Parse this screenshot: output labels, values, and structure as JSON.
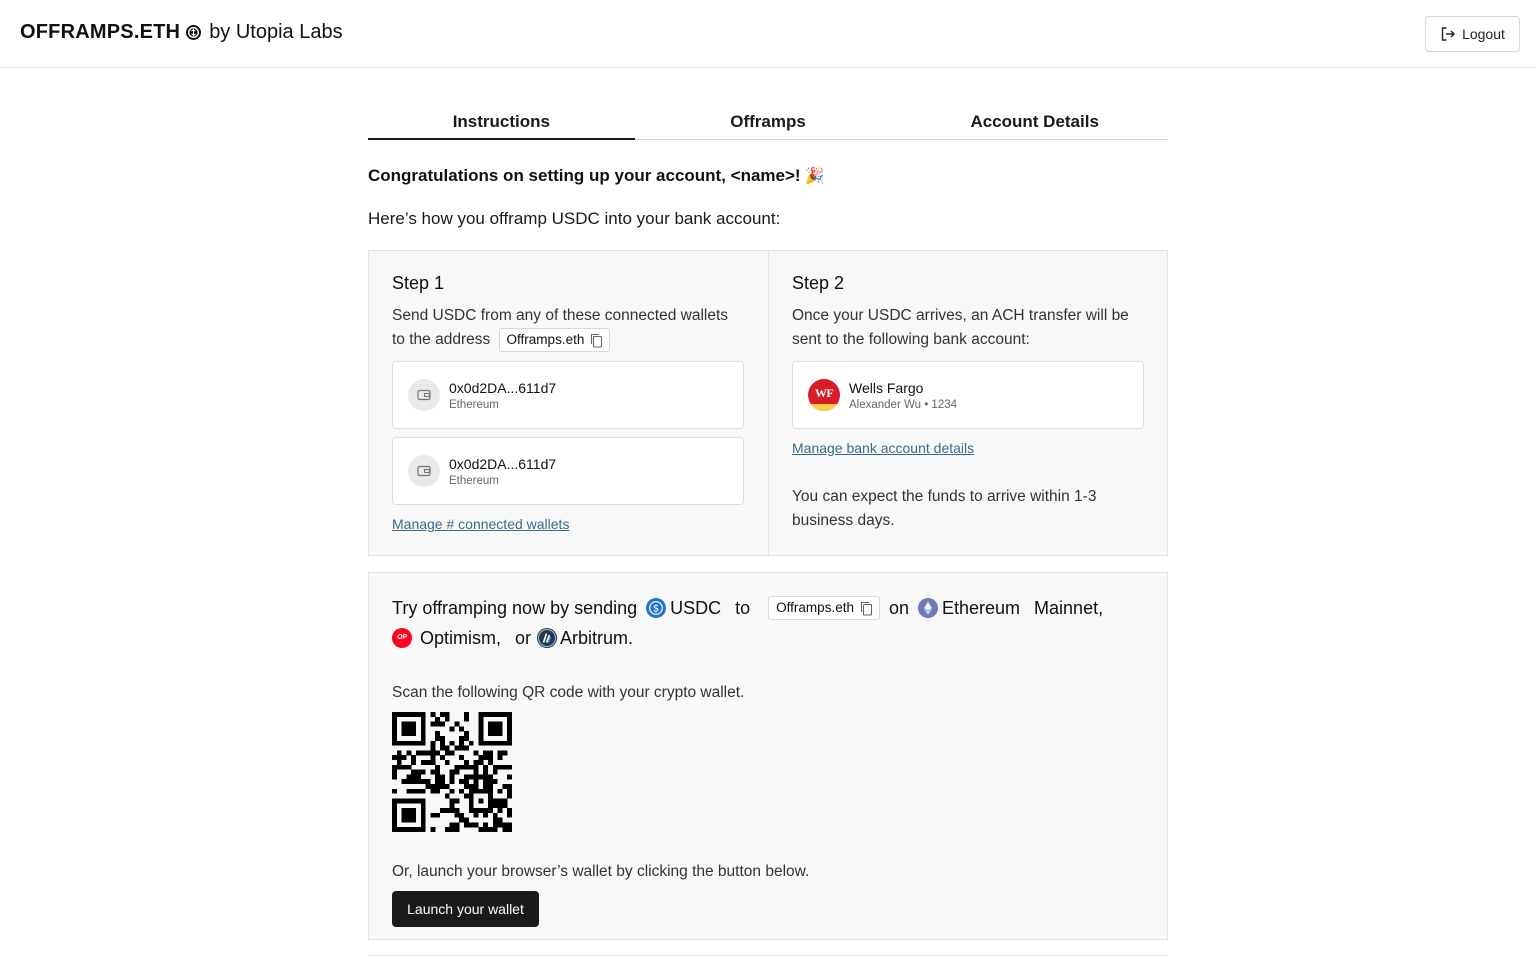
{
  "header": {
    "brand_name": "OFFRAMPS.ETH",
    "brand_suffix": "by Utopia Labs",
    "logout_label": "Logout"
  },
  "tabs": [
    {
      "label": "Instructions",
      "active": true
    },
    {
      "label": "Offramps",
      "active": false
    },
    {
      "label": "Account Details",
      "active": false
    }
  ],
  "intro": {
    "congrats": "Congratulations on setting up your account, <name>!",
    "party_emoji": "🎉",
    "howto": "Here’s how you offramp USDC into your bank account:"
  },
  "step1": {
    "title": "Step 1",
    "text": "Send USDC from any of these connected wallets to the address",
    "address_chip": "Offramps.eth",
    "wallets": [
      {
        "address": "0x0d2DA...611d7",
        "network": "Ethereum"
      },
      {
        "address": "0x0d2DA...611d7",
        "network": "Ethereum"
      }
    ],
    "manage_link": "Manage # connected wallets"
  },
  "step2": {
    "title": "Step 2",
    "text": "Once your USDC arrives, an ACH transfer will be sent to the following bank account:",
    "bank": {
      "name": "Wells Fargo",
      "detail": "Alexander Wu • 1234",
      "logo_text": "WF"
    },
    "manage_link": "Manage bank account details",
    "expect": "You can expect the funds to arrive within 1-3 business days."
  },
  "try": {
    "prefix": "Try offramping now by sending",
    "token": "USDC",
    "to": "to",
    "address_chip": "Offramps.eth",
    "on": "on",
    "net1": "Ethereum",
    "net1b": "Mainnet,",
    "net2": "Optimism,",
    "or": "or",
    "net3": "Arbitrum.",
    "op_badge": "OP",
    "scan_text": "Scan the following QR code with your crypto wallet.",
    "launch_text": "Or, launch your browser’s wallet by clicking the button below.",
    "launch_button": "Launch your wallet"
  },
  "colors": {
    "usdc": "#2775ca",
    "ethereum": "#6b7bb8",
    "optimism": "#ff0420",
    "arbitrum": "#2d374b",
    "wells_fargo_red": "#d71e28",
    "wells_fargo_gold": "#ffcd41",
    "link": "#3c6a8a"
  }
}
